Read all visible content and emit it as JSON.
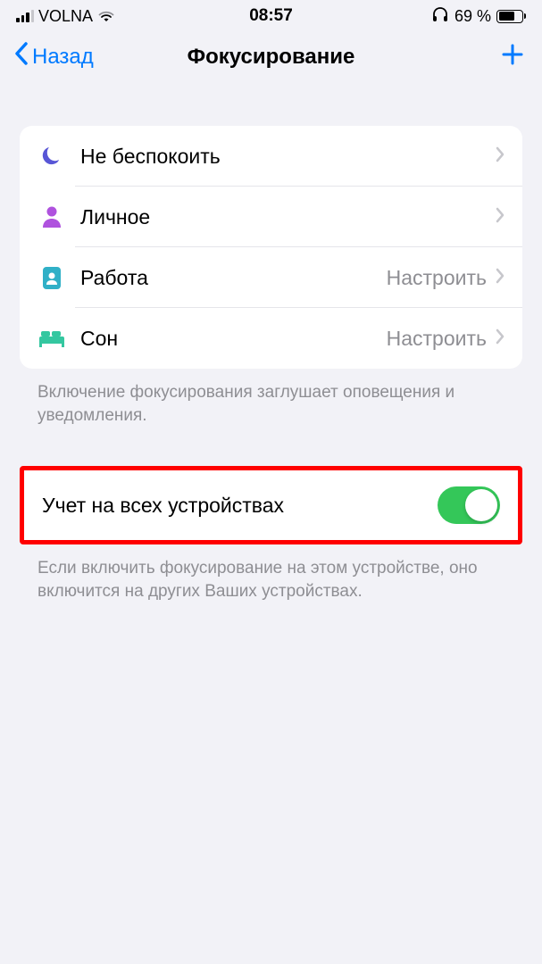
{
  "status": {
    "carrier": "VOLNA",
    "time": "08:57",
    "battery_percent": "69 %"
  },
  "nav": {
    "back_label": "Назад",
    "title": "Фокусирование"
  },
  "focus_modes": [
    {
      "label": "Не беспокоить",
      "detail": ""
    },
    {
      "label": "Личное",
      "detail": ""
    },
    {
      "label": "Работа",
      "detail": "Настроить"
    },
    {
      "label": "Сон",
      "detail": "Настроить"
    }
  ],
  "footer1": "Включение фокусирования заглушает оповещения и уведомления.",
  "share_row": {
    "label": "Учет на всех устройствах"
  },
  "footer2": "Если включить фокусирование на этом устройстве, оно включится на других Ваших устройствах."
}
